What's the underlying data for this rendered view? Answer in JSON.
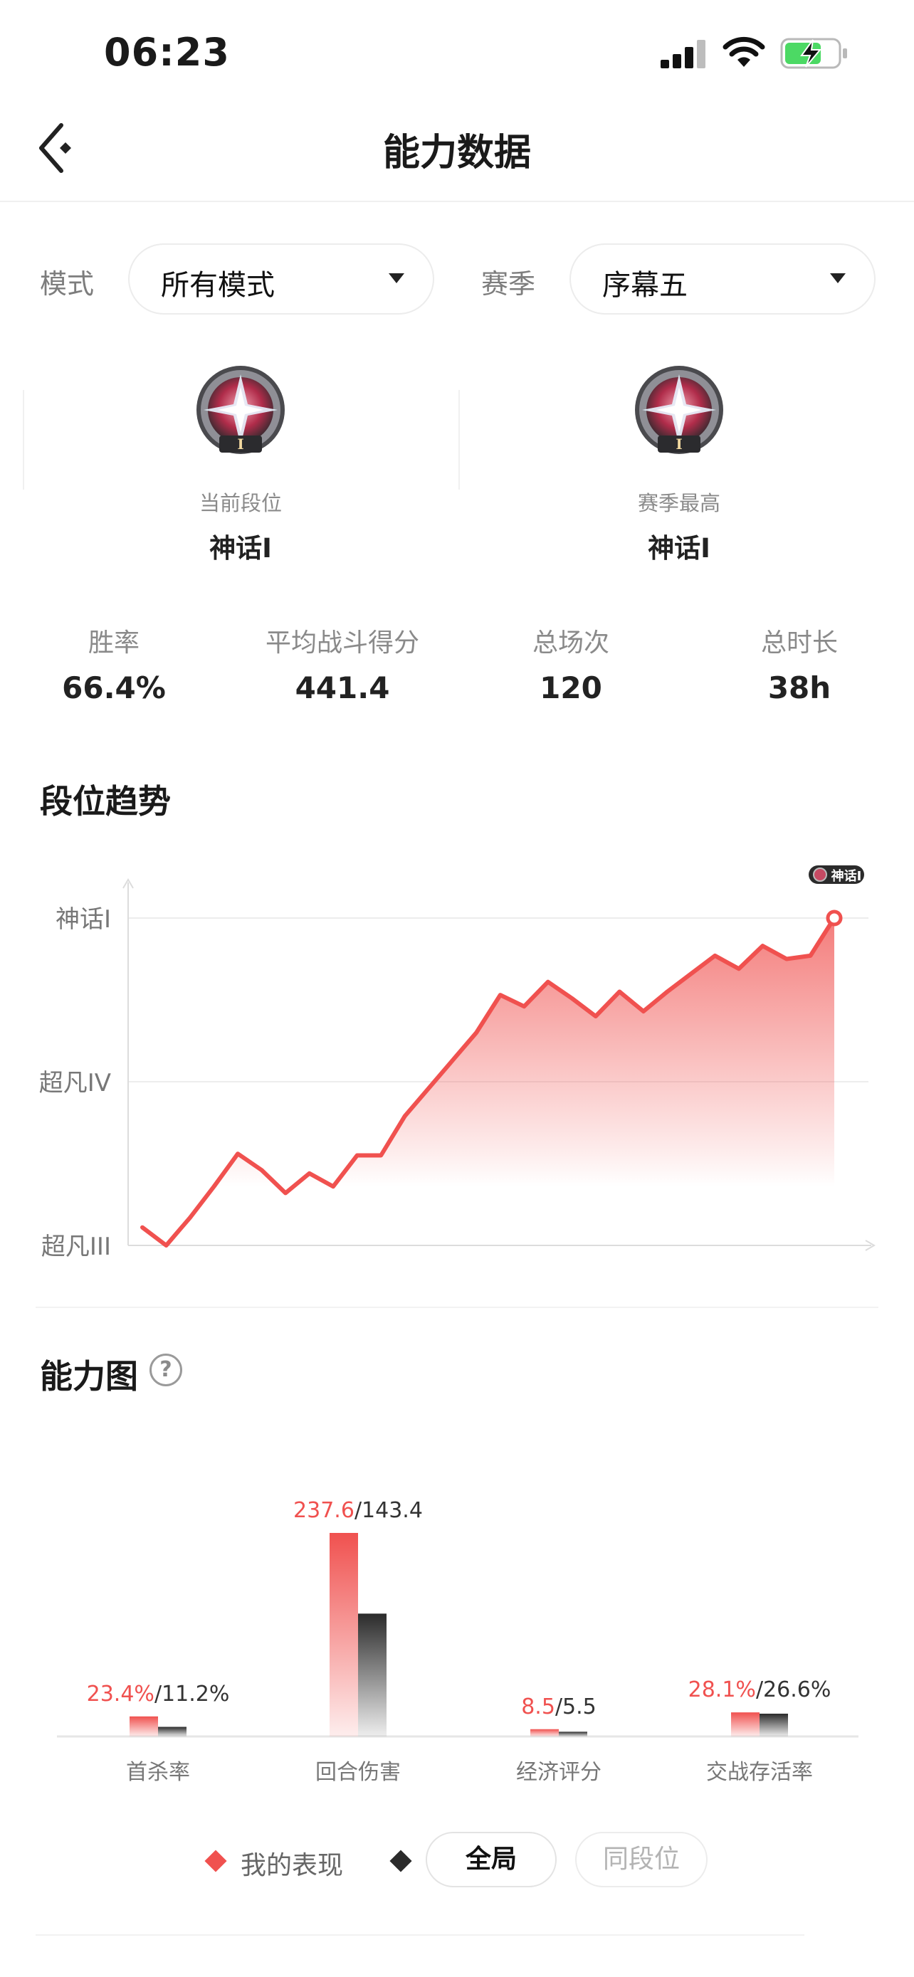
{
  "status_bar": {
    "time": "06:23"
  },
  "nav": {
    "title": "能力数据"
  },
  "filters": {
    "mode_label": "模式",
    "mode_value": "所有模式",
    "season_label": "赛季",
    "season_value": "序幕五"
  },
  "ranks": {
    "current_caption": "当前段位",
    "current_name": "神话I",
    "best_caption": "赛季最高",
    "best_name": "神话I"
  },
  "stats": [
    {
      "label": "胜率",
      "value": "66.4%"
    },
    {
      "label": "平均战斗得分",
      "value": "441.4"
    },
    {
      "label": "总场次",
      "value": "120"
    },
    {
      "label": "总时长",
      "value": "38h"
    }
  ],
  "trend": {
    "title": "段位趋势",
    "y_labels": [
      "神话I",
      "超凡IV",
      "超凡III"
    ],
    "badge_text": "神话I"
  },
  "ability": {
    "title": "能力图",
    "help_icon": "question-circle-icon"
  },
  "legend": {
    "mine_label": "我的表现",
    "pill_all": "全局",
    "pill_same_rank": "同段位"
  },
  "colors": {
    "accent": "#f0514f",
    "dark": "#2b2b2b",
    "battery_green": "#4cd964"
  },
  "chart_data": [
    {
      "type": "area",
      "title": "段位趋势",
      "y_ticks": [
        "超凡III",
        "超凡IV",
        "神话I"
      ],
      "ylim": [
        0,
        2
      ],
      "x": [
        0,
        1,
        2,
        3,
        4,
        5,
        6,
        7,
        8,
        9,
        10,
        11,
        12,
        13,
        14,
        15,
        16,
        17,
        18,
        19,
        20,
        21,
        22,
        23,
        24,
        25,
        26,
        27,
        28,
        29
      ],
      "values": [
        0.11,
        0.0,
        0.17,
        0.36,
        0.56,
        0.46,
        0.32,
        0.44,
        0.36,
        0.55,
        0.55,
        0.79,
        0.96,
        1.13,
        1.3,
        1.53,
        1.46,
        1.61,
        1.51,
        1.4,
        1.55,
        1.43,
        1.55,
        1.66,
        1.77,
        1.69,
        1.83,
        1.75,
        1.77,
        2.0
      ],
      "grid": true,
      "legend": "none"
    },
    {
      "type": "bar",
      "categories": [
        "首杀率",
        "回合伤害",
        "经济评分",
        "交战存活率"
      ],
      "series": [
        {
          "name": "我的表现",
          "values": [
            23.4,
            237.6,
            8.5,
            28.1
          ],
          "labels": [
            "23.4%",
            "237.6",
            "8.5",
            "28.1%"
          ]
        },
        {
          "name": "全局",
          "values": [
            11.2,
            143.4,
            5.5,
            26.6
          ],
          "labels": [
            "11.2%",
            "143.4",
            "5.5",
            "26.6%"
          ]
        }
      ]
    }
  ]
}
